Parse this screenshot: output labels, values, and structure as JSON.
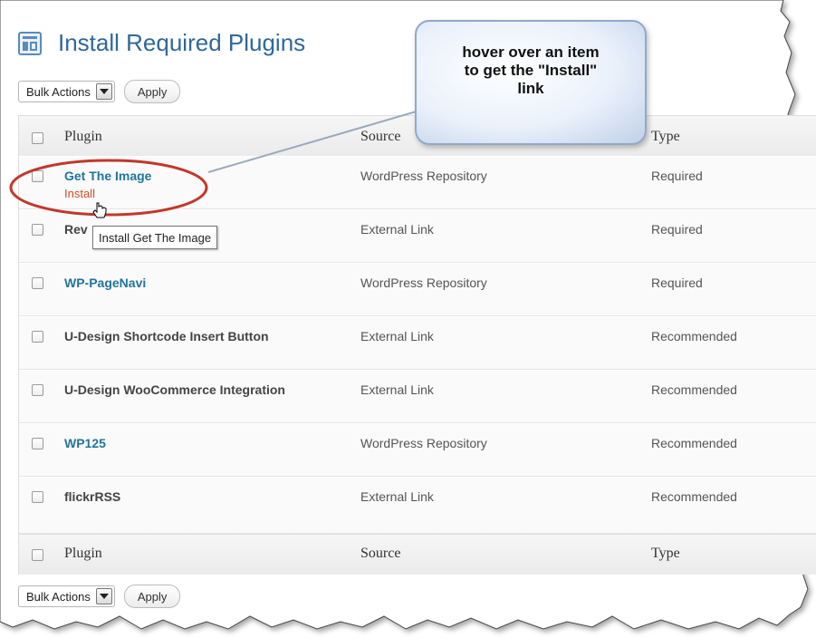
{
  "title": "Install Required Plugins",
  "bulk_top": {
    "select_label": "Bulk Actions",
    "apply_label": "Apply"
  },
  "bulk_bottom": {
    "select_label": "Bulk Actions",
    "apply_label": "Apply"
  },
  "columns": {
    "plugin": "Plugin",
    "source": "Source",
    "type": "Type"
  },
  "rows": [
    {
      "name": "Get The Image",
      "source": "WordPress Repository",
      "type": "Required",
      "action": "Install",
      "linked": true
    },
    {
      "name": "Rev",
      "source": "External Link",
      "type": "Required",
      "linked": false
    },
    {
      "name": "WP-PageNavi",
      "source": "WordPress Repository",
      "type": "Required",
      "linked": true
    },
    {
      "name": "U-Design Shortcode Insert Button",
      "source": "External Link",
      "type": "Recommended",
      "linked": false
    },
    {
      "name": "U-Design WooCommerce Integration",
      "source": "External Link",
      "type": "Recommended",
      "linked": false
    },
    {
      "name": "WP125",
      "source": "WordPress Repository",
      "type": "Recommended",
      "linked": true
    },
    {
      "name": "flickrRSS",
      "source": "External Link",
      "type": "Recommended",
      "linked": false
    }
  ],
  "tooltip": "Install Get The Image",
  "callout": {
    "line1": "hover over an item",
    "line2": "to get the \"Install\"",
    "line3": "link"
  },
  "colors": {
    "link": "#21759b",
    "install": "#d54e21",
    "highlight": "#c0392b",
    "title": "#30689a"
  }
}
